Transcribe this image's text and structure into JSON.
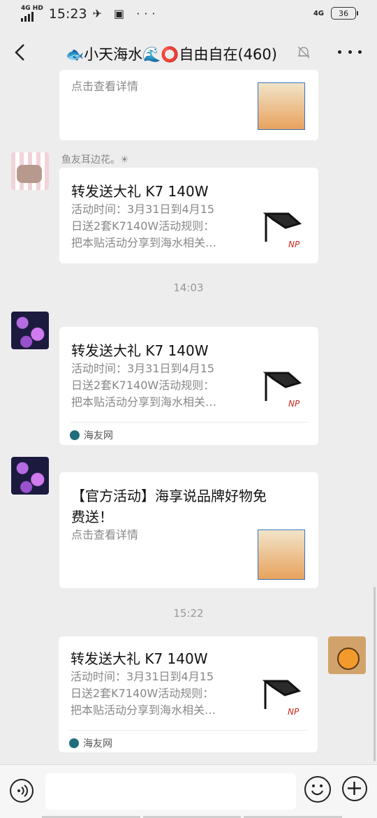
{
  "status_bar": {
    "network": "4G HD",
    "time": "15:23",
    "right_network": "4G",
    "battery": "36"
  },
  "header": {
    "title": "🐟小天海水🌊⭕自由自在(460)"
  },
  "messages": [
    {
      "desc": "点击查看详情"
    },
    {
      "sender": "鱼友耳边花。☀",
      "title": "转发送大礼 K7 140W",
      "desc_lines": [
        "活动时间：3月31日到4月15",
        "日送2套K7140W活动规则：",
        "把本贴活动分享到海水相关…"
      ]
    },
    {
      "time": "14:03"
    },
    {
      "title": "转发送大礼 K7 140W",
      "desc_lines": [
        "活动时间：3月31日到4月15",
        "日送2套K7140W活动规则：",
        "把本贴活动分享到海水相关…"
      ],
      "source": "海友网"
    },
    {
      "title_lines": [
        "【官方活动】海享说品牌好物免",
        "费送！"
      ],
      "desc": "点击查看详情"
    },
    {
      "time": "15:22"
    },
    {
      "title": "转发送大礼 K7 140W",
      "desc_lines": [
        "活动时间：3月31日到4月15",
        "日送2套K7140W活动规则：",
        "把本贴活动分享到海水相关…"
      ],
      "source": "海友网"
    }
  ],
  "thumb_text": "NP",
  "colors": {
    "background": "#ededed",
    "card": "#ffffff",
    "accent_red": "#d0271d"
  }
}
